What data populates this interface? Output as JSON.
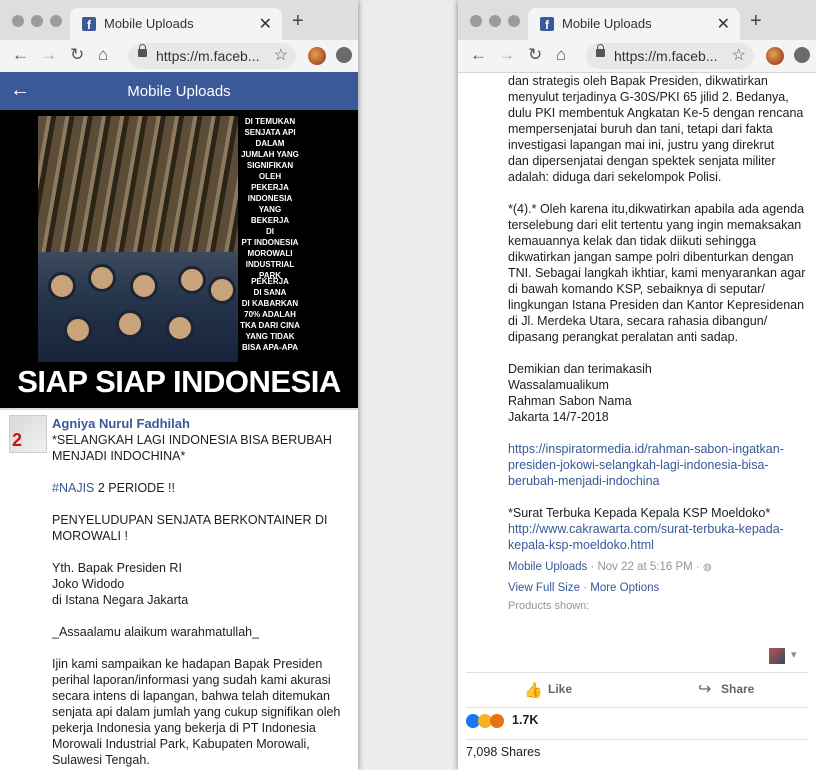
{
  "browser": {
    "tab_title": "Mobile Uploads",
    "url": "https://m.faceb..."
  },
  "fb_header": {
    "title": "Mobile Uploads"
  },
  "photo_overlay": {
    "lines_top": [
      "DI TEMUKAN",
      "SENJATA API",
      "DALAM",
      "JUMLAH YANG SIGNIFIKAN",
      "OLEH PEKERJA",
      "INDONESIA",
      "YANG BEKERJA",
      "DI",
      "PT INDONESIA",
      "MOROWALI",
      "INDUSTRIAL",
      "PARK"
    ],
    "lines_bottom": [
      "PEKERJA",
      "DI SANA",
      "DI KABARKAN",
      "70% ADALAH",
      "TKA DARI CINA",
      "YANG TIDAK",
      "BISA APA-APA"
    ],
    "title": "SIAP SIAP INDONESIA"
  },
  "post": {
    "author": "Agniya Nurul Fadhilah",
    "avatar_badge": "2",
    "left_lines": [
      "*SELANGKAH LAGI INDONESIA BISA BERUBAH",
      "MENJADI INDOCHINA*",
      "",
      "",
      "PENYELUDUPAN SENJATA BERKONTAINER DI",
      "MOROWALI !",
      "",
      "Yth. Bapak Presiden RI",
      "Joko Widodo",
      "di Istana Negara Jakarta",
      "",
      "_Assaalamu alaikum warahmatullah_",
      "",
      "Ijin kami sampaikan ke hadapan Bapak Presiden",
      "perihal laporan/informasi yang sudah kami akurasi",
      "secara intens di lapangan, bahwa telah ditemukan",
      "senjata api dalam jumlah yang cukup signifikan oleh",
      "pekerja Indonesia yang bekerja di PT Indonesia",
      "Morowali Industrial Park, Kabupaten Morowali,",
      "Sulawesi Tengah."
    ],
    "hashtag": "#NAJIS",
    "hashtag_rest": " 2 PERIODE !!",
    "right_lines": [
      "dan strategis oleh Bapak Presiden, dikwatirkan",
      "menyulut terjadinya G-30S/PKI 65 jilid 2. Bedanya,",
      "dulu PKI membentuk Angkatan Ke-5 dengan rencana",
      "mempersenjatai buruh dan tani, tetapi dari fakta",
      "investigasi lapangan mai ini, justru yang direkrut",
      "dan dipersenjatai dengan spektek senjata militer",
      "adalah: diduga dari sekelompok Polisi.",
      "",
      "*(4).* Oleh karena itu,dikwatirkan apabila ada agenda",
      "terselebung dari elit tertentu yang ingin memaksakan",
      "kemauannya kelak dan tidak diikuti sehingga",
      "dikwatirkan jangan sampe polri dibenturkan dengan",
      "TNI. Sebagai langkah ikhtiar, kami menyarankan agar",
      "di bawah komando KSP, sebaiknya di seputar/",
      "lingkungan Istana Presiden dan Kantor Kepresidenan",
      "di Jl. Merdeka Utara, secara rahasia dibangun/",
      "dipasang perangkat peralatan anti sadap.",
      "",
      "Demikian dan terimakasih",
      "Wassalamualikum",
      "Rahman Sabon Nama",
      "Jakarta 14/7-2018"
    ],
    "link1_lines": [
      "https://inspiratormedia.id/rahman-sabon-ingatkan-",
      "presiden-jokowi-selangkah-lagi-indonesia-bisa-",
      "berubah-menjadi-indochina"
    ],
    "surat_title": "*Surat Terbuka Kepada Kepala KSP Moeldoko*",
    "link2_lines": [
      "http://www.cakrawarta.com/surat-terbuka-kepada-",
      "kepala-ksp-moeldoko.html"
    ],
    "album": "Mobile Uploads",
    "date": " · Nov 22 at 5:16 PM ·",
    "view_full": "View Full Size",
    "sep": " · ",
    "more_options": "More Options",
    "products": "Products shown:",
    "like": "Like",
    "share": "Share",
    "reaction_count": "1.7K",
    "shares": "7,098 Shares"
  },
  "colors": {
    "facebook_blue": "#3b5998",
    "link_blue": "#385898"
  }
}
